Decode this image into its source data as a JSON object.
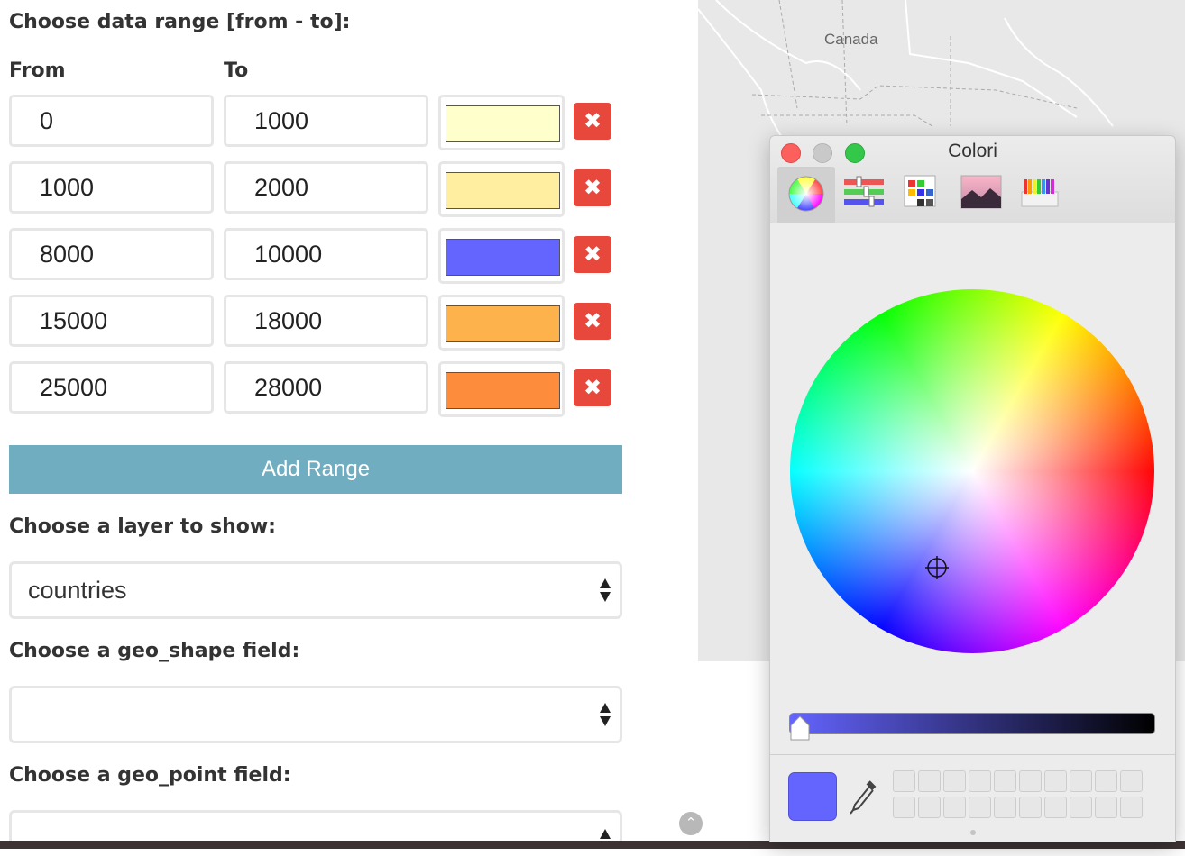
{
  "form": {
    "range_heading": "Choose data range [from - to]:",
    "from_label": "From",
    "to_label": "To",
    "ranges": [
      {
        "from": "0",
        "to": "1000",
        "color": "#ffffcc"
      },
      {
        "from": "1000",
        "to": "2000",
        "color": "#ffeda0"
      },
      {
        "from": "8000",
        "to": "10000",
        "color": "#6464ff"
      },
      {
        "from": "15000",
        "to": "18000",
        "color": "#feb24c"
      },
      {
        "from": "25000",
        "to": "28000",
        "color": "#fd8d3c"
      }
    ],
    "delete_glyph": "✖",
    "add_range_label": "Add Range",
    "layer_heading": "Choose a layer to show:",
    "layer_value": "countries",
    "geo_shape_heading": "Choose a geo_shape field:",
    "geo_shape_value": "",
    "geo_point_heading": "Choose a geo_point field:",
    "geo_point_value": ""
  },
  "map": {
    "label": "Canada",
    "scroll_up_glyph": "⌃"
  },
  "color_panel": {
    "title": "Colori",
    "tools": [
      "color-wheel-icon",
      "color-sliders-icon",
      "color-palettes-icon",
      "image-palettes-icon",
      "pencils-icon"
    ],
    "active_tool": "color-wheel-icon",
    "current_color": "#6464ff",
    "brightness": 1.0
  }
}
